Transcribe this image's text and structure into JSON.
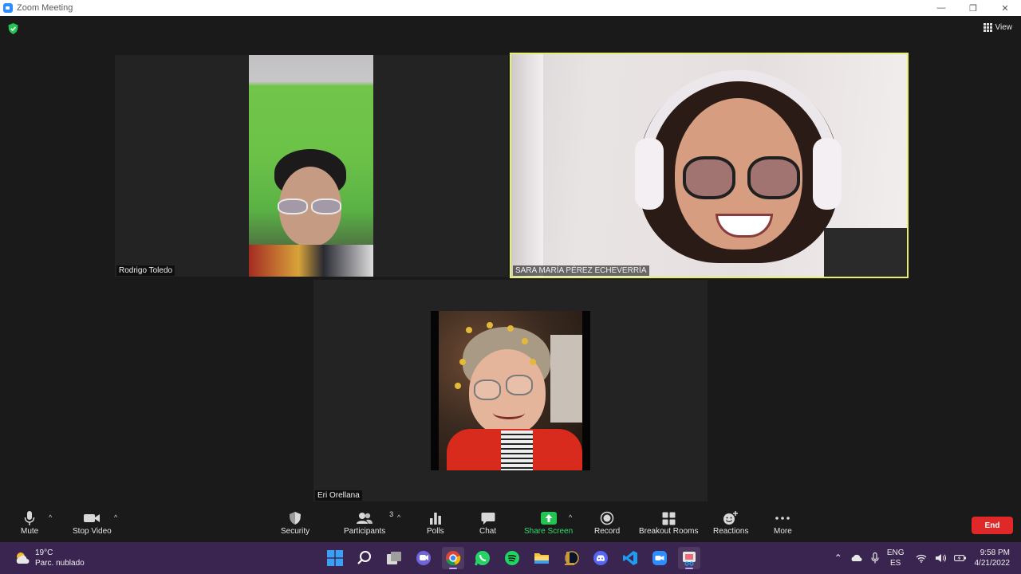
{
  "window": {
    "title": "Zoom Meeting"
  },
  "top": {
    "view_label": "View"
  },
  "participants": [
    {
      "name": "Rodrigo Toledo"
    },
    {
      "name": "SARA MARÍA PÉREZ ECHEVERRÍA"
    },
    {
      "name": "Eri Orellana"
    }
  ],
  "toolbar": {
    "mute": "Mute",
    "stop_video": "Stop Video",
    "security": "Security",
    "participants": "Participants",
    "participants_count": "3",
    "polls": "Polls",
    "chat": "Chat",
    "share_screen": "Share Screen",
    "record": "Record",
    "breakout_rooms": "Breakout Rooms",
    "reactions": "Reactions",
    "more": "More",
    "end": "End"
  },
  "taskbar": {
    "weather_temp": "19°C",
    "weather_desc": "Parc. nublado",
    "lang_1": "ENG",
    "lang_2": "ES",
    "time": "9:58 PM",
    "date": "4/21/2022"
  },
  "colors": {
    "active_speaker_border": "#e7f06a",
    "share_green": "#2fdc6e",
    "end_red": "#e02828",
    "taskbar": "#3a2450"
  }
}
